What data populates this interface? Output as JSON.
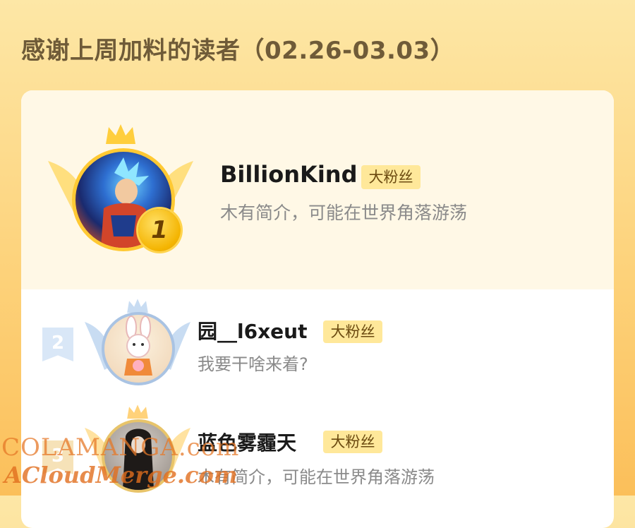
{
  "header": {
    "title": "感谢上周加料的读者（02.26-03.03）"
  },
  "readers": [
    {
      "rank": "1",
      "name": "BillionKind",
      "badge": "大粉丝",
      "bio": "木有简介，可能在世界角落游荡"
    },
    {
      "rank": "2",
      "name": "园__l6xeut",
      "badge": "大粉丝",
      "bio": "我要干啥来着?"
    },
    {
      "rank": "3",
      "name": "蓝色雾霾天",
      "badge": "大粉丝",
      "bio": "木有简介，可能在世界角落游荡"
    }
  ],
  "watermark": {
    "line1": "COLAMANGA.com",
    "line2": "ACloudMerge.com"
  },
  "colors": {
    "gold": "#f4b400",
    "silver": "#a9c3e3",
    "badge_bg": "#ffe89a",
    "title": "#6f5b38"
  }
}
